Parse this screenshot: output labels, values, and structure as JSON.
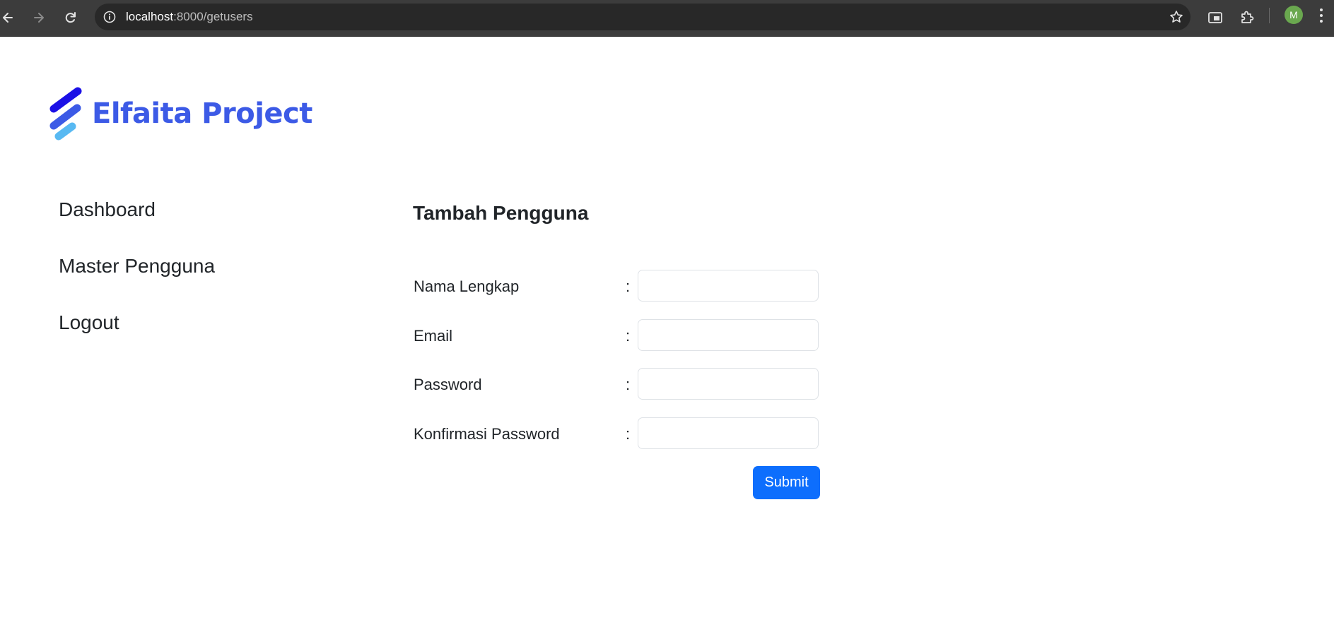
{
  "browser": {
    "url_host": "localhost",
    "url_path": ":8000/getusers",
    "profile_initial": "M",
    "icons": {
      "back": "back-arrow-icon",
      "forward": "forward-arrow-icon",
      "reload": "reload-icon",
      "site_info": "info-icon",
      "bookmark": "star-icon",
      "reading_mode": "side-panel-icon",
      "extensions": "puzzle-icon",
      "menu": "kebab-menu-icon"
    }
  },
  "brand": {
    "name": "Elfaita Project",
    "color": "#3c5ae6"
  },
  "sidebar": {
    "items": [
      {
        "label": "Dashboard"
      },
      {
        "label": "Master Pengguna"
      },
      {
        "label": "Logout"
      }
    ]
  },
  "form": {
    "title": "Tambah Pengguna",
    "colon": ":",
    "fields": [
      {
        "label": "Nama Lengkap",
        "value": ""
      },
      {
        "label": "Email",
        "value": ""
      },
      {
        "label": "Password",
        "value": ""
      },
      {
        "label": "Konfirmasi Password",
        "value": ""
      }
    ],
    "submit_label": "Submit",
    "submit_color": "#0d6efd"
  }
}
